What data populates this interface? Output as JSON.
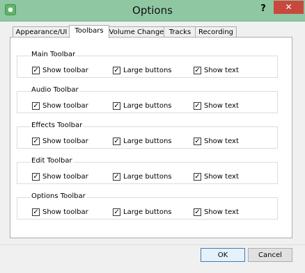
{
  "window": {
    "title": "Options",
    "help_glyph": "?",
    "close_glyph": "✕"
  },
  "tabs": [
    {
      "label": "Appearance/UI",
      "active": false
    },
    {
      "label": "Toolbars",
      "active": true
    },
    {
      "label": "Volume Change",
      "active": false
    },
    {
      "label": "Tracks",
      "active": false
    },
    {
      "label": "Recording",
      "active": false
    }
  ],
  "groups": [
    {
      "title": "Main Toolbar",
      "options": [
        {
          "label": "Show toolbar",
          "checked": true
        },
        {
          "label": "Large buttons",
          "checked": true
        },
        {
          "label": "Show text",
          "checked": true
        }
      ]
    },
    {
      "title": "Audio Toolbar",
      "options": [
        {
          "label": "Show toolbar",
          "checked": true
        },
        {
          "label": "Large buttons",
          "checked": true
        },
        {
          "label": "Show text",
          "checked": true
        }
      ]
    },
    {
      "title": "Effects Toolbar",
      "options": [
        {
          "label": "Show toolbar",
          "checked": true
        },
        {
          "label": "Large buttons",
          "checked": true
        },
        {
          "label": "Show text",
          "checked": true
        }
      ]
    },
    {
      "title": "Edit Toolbar",
      "options": [
        {
          "label": "Show toolbar",
          "checked": true
        },
        {
          "label": "Large buttons",
          "checked": true
        },
        {
          "label": "Show text",
          "checked": true
        }
      ]
    },
    {
      "title": "Options Toolbar",
      "options": [
        {
          "label": "Show toolbar",
          "checked": true
        },
        {
          "label": "Large buttons",
          "checked": true
        },
        {
          "label": "Show text",
          "checked": true
        }
      ]
    }
  ],
  "buttons": {
    "ok": "OK",
    "cancel": "Cancel"
  },
  "check_glyph": "✓"
}
